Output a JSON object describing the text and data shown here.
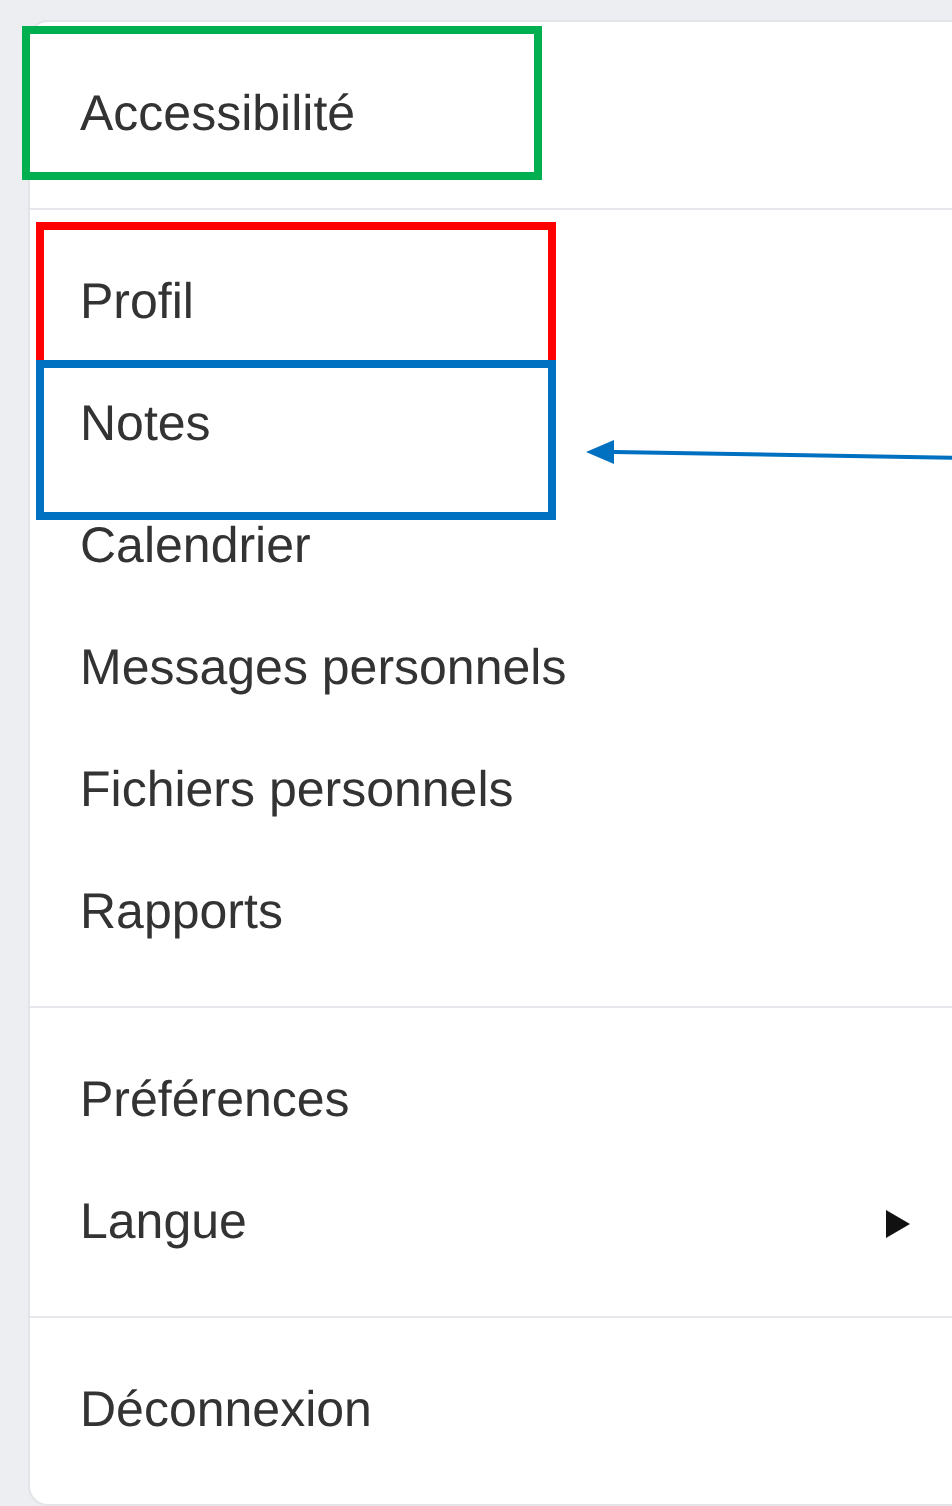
{
  "menu": {
    "groups": [
      {
        "items": [
          {
            "label": "Accessibilité",
            "has_submenu": false,
            "annotation": {
              "color": "#00b050"
            },
            "arrow": false
          }
        ]
      },
      {
        "items": [
          {
            "label": "Profil",
            "has_submenu": false,
            "annotation": {
              "color": "#ff0000"
            },
            "arrow": false
          },
          {
            "label": "Notes",
            "has_submenu": false,
            "annotation": {
              "color": "#0070c0"
            },
            "arrow": true
          },
          {
            "label": "Calendrier",
            "has_submenu": false,
            "arrow": false
          },
          {
            "label": "Messages personnels",
            "has_submenu": false,
            "arrow": false
          },
          {
            "label": "Fichiers personnels",
            "has_submenu": false,
            "arrow": false
          },
          {
            "label": "Rapports",
            "has_submenu": false,
            "arrow": false
          }
        ]
      },
      {
        "items": [
          {
            "label": "Préférences",
            "has_submenu": false,
            "arrow": false
          },
          {
            "label": "Langue",
            "has_submenu": true,
            "arrow": false
          }
        ]
      },
      {
        "items": [
          {
            "label": "Déconnexion",
            "has_submenu": false,
            "arrow": false
          }
        ]
      }
    ]
  }
}
